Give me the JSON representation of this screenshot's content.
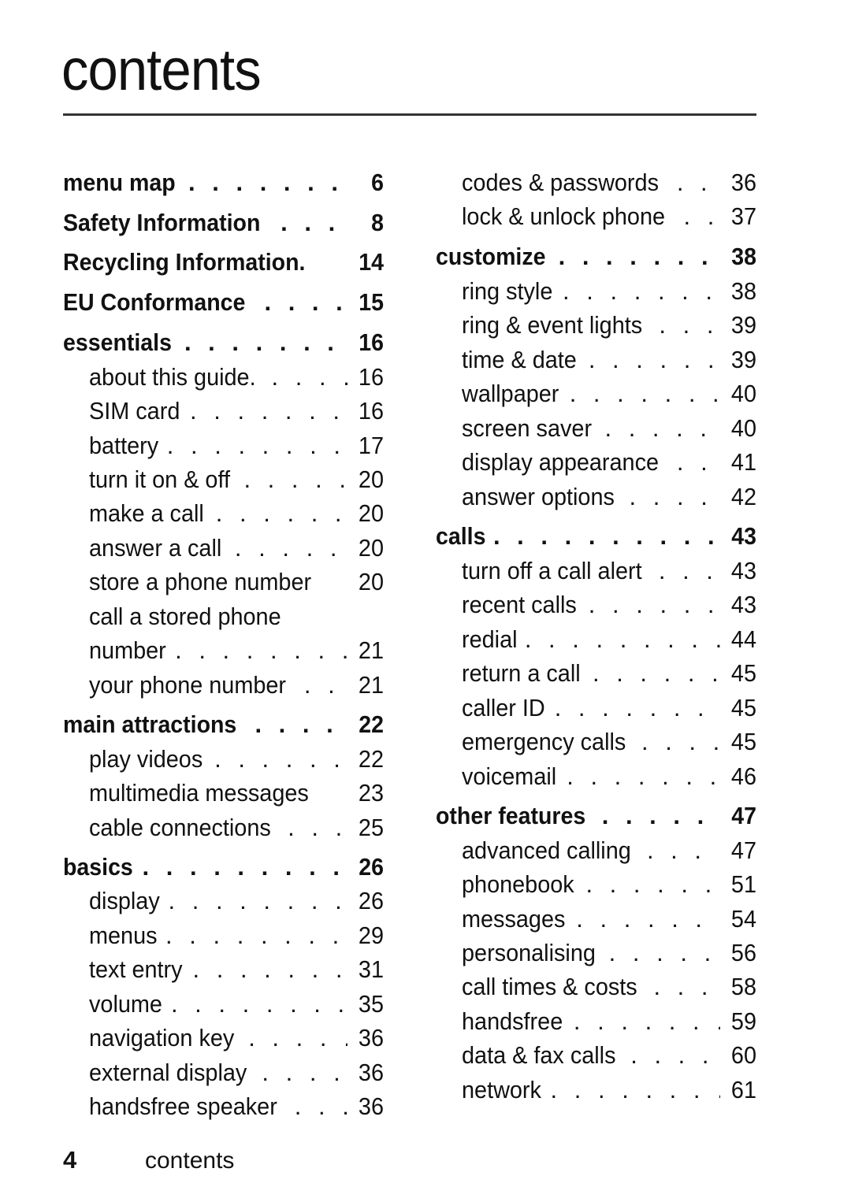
{
  "page": {
    "title": "contents",
    "footer": {
      "page_number": "4",
      "section": "contents"
    }
  },
  "toc": {
    "left": [
      {
        "label": "menu map",
        "page": "6",
        "level": "heading"
      },
      {
        "label": "Safety Information",
        "page": "8",
        "level": "heading"
      },
      {
        "label": "Recycling Information.",
        "page": "14",
        "level": "heading",
        "dots": false
      },
      {
        "label": "EU Conformance",
        "page": "15",
        "level": "heading"
      },
      {
        "label": "essentials",
        "page": "16",
        "level": "heading"
      },
      {
        "label": "about this guide.",
        "page": "16",
        "level": "sub"
      },
      {
        "label": "SIM card",
        "page": "16",
        "level": "sub"
      },
      {
        "label": "battery",
        "page": "17",
        "level": "sub"
      },
      {
        "label": "turn it on & off",
        "page": "20",
        "level": "sub"
      },
      {
        "label": "make a call",
        "page": "20",
        "level": "sub"
      },
      {
        "label": "answer a call",
        "page": "20",
        "level": "sub"
      },
      {
        "label": "store a phone number",
        "page": "20",
        "level": "sub",
        "dots": false
      },
      {
        "label": "call a stored phone",
        "page": "",
        "level": "sub",
        "dots": false
      },
      {
        "label": "number",
        "page": "21",
        "level": "sub"
      },
      {
        "label": "your phone number",
        "page": "21",
        "level": "sub"
      },
      {
        "label": "main attractions",
        "page": "22",
        "level": "heading"
      },
      {
        "label": "play videos",
        "page": "22",
        "level": "sub"
      },
      {
        "label": "multimedia messages",
        "page": "23",
        "level": "sub",
        "dots": false
      },
      {
        "label": "cable connections",
        "page": "25",
        "level": "sub"
      },
      {
        "label": "basics",
        "page": "26",
        "level": "heading"
      },
      {
        "label": "display",
        "page": "26",
        "level": "sub"
      },
      {
        "label": "menus",
        "page": "29",
        "level": "sub"
      },
      {
        "label": "text entry",
        "page": "31",
        "level": "sub"
      },
      {
        "label": "volume",
        "page": "35",
        "level": "sub"
      },
      {
        "label": "navigation key",
        "page": "36",
        "level": "sub"
      },
      {
        "label": "external display",
        "page": "36",
        "level": "sub"
      },
      {
        "label": "handsfree speaker",
        "page": "36",
        "level": "sub"
      }
    ],
    "right": [
      {
        "label": "codes & passwords",
        "page": "36",
        "level": "sub"
      },
      {
        "label": "lock & unlock phone",
        "page": "37",
        "level": "sub"
      },
      {
        "label": "customize",
        "page": "38",
        "level": "heading"
      },
      {
        "label": "ring style",
        "page": "38",
        "level": "sub"
      },
      {
        "label": "ring & event lights",
        "page": "39",
        "level": "sub"
      },
      {
        "label": "time & date",
        "page": "39",
        "level": "sub"
      },
      {
        "label": "wallpaper",
        "page": "40",
        "level": "sub"
      },
      {
        "label": "screen saver",
        "page": "40",
        "level": "sub"
      },
      {
        "label": "display appearance",
        "page": "41",
        "level": "sub"
      },
      {
        "label": "answer options",
        "page": "42",
        "level": "sub"
      },
      {
        "label": "calls",
        "page": "43",
        "level": "heading"
      },
      {
        "label": "turn off a call alert",
        "page": "43",
        "level": "sub"
      },
      {
        "label": "recent calls",
        "page": "43",
        "level": "sub"
      },
      {
        "label": "redial",
        "page": "44",
        "level": "sub"
      },
      {
        "label": "return a call",
        "page": "45",
        "level": "sub"
      },
      {
        "label": "caller ID",
        "page": "45",
        "level": "sub"
      },
      {
        "label": "emergency calls",
        "page": "45",
        "level": "sub"
      },
      {
        "label": "voicemail",
        "page": "46",
        "level": "sub"
      },
      {
        "label": "other features",
        "page": "47",
        "level": "heading"
      },
      {
        "label": "advanced calling",
        "page": "47",
        "level": "sub"
      },
      {
        "label": "phonebook",
        "page": "51",
        "level": "sub"
      },
      {
        "label": "messages",
        "page": "54",
        "level": "sub"
      },
      {
        "label": "personalising",
        "page": "56",
        "level": "sub"
      },
      {
        "label": "call times & costs",
        "page": "58",
        "level": "sub"
      },
      {
        "label": "handsfree",
        "page": "59",
        "level": "sub"
      },
      {
        "label": "data & fax calls",
        "page": "60",
        "level": "sub"
      },
      {
        "label": "network",
        "page": "61",
        "level": "sub"
      }
    ]
  }
}
